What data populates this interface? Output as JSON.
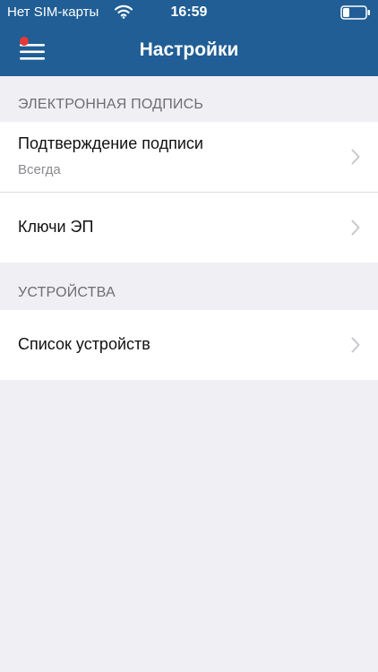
{
  "status_bar": {
    "carrier": "Нет SIM-карты",
    "time": "16:59"
  },
  "header": {
    "title": "Настройки",
    "menu_icon": "hamburger-menu-icon",
    "notification_color": "#e53935",
    "background_color": "#205e95"
  },
  "sections": [
    {
      "title": "ЭЛЕКТРОННАЯ ПОДПИСЬ",
      "rows": [
        {
          "label": "Подтверждение подписи",
          "value": "Всегда"
        },
        {
          "label": "Ключи ЭП"
        }
      ]
    },
    {
      "title": "УСТРОЙСТВА",
      "rows": [
        {
          "label": "Список устройств"
        }
      ]
    }
  ]
}
